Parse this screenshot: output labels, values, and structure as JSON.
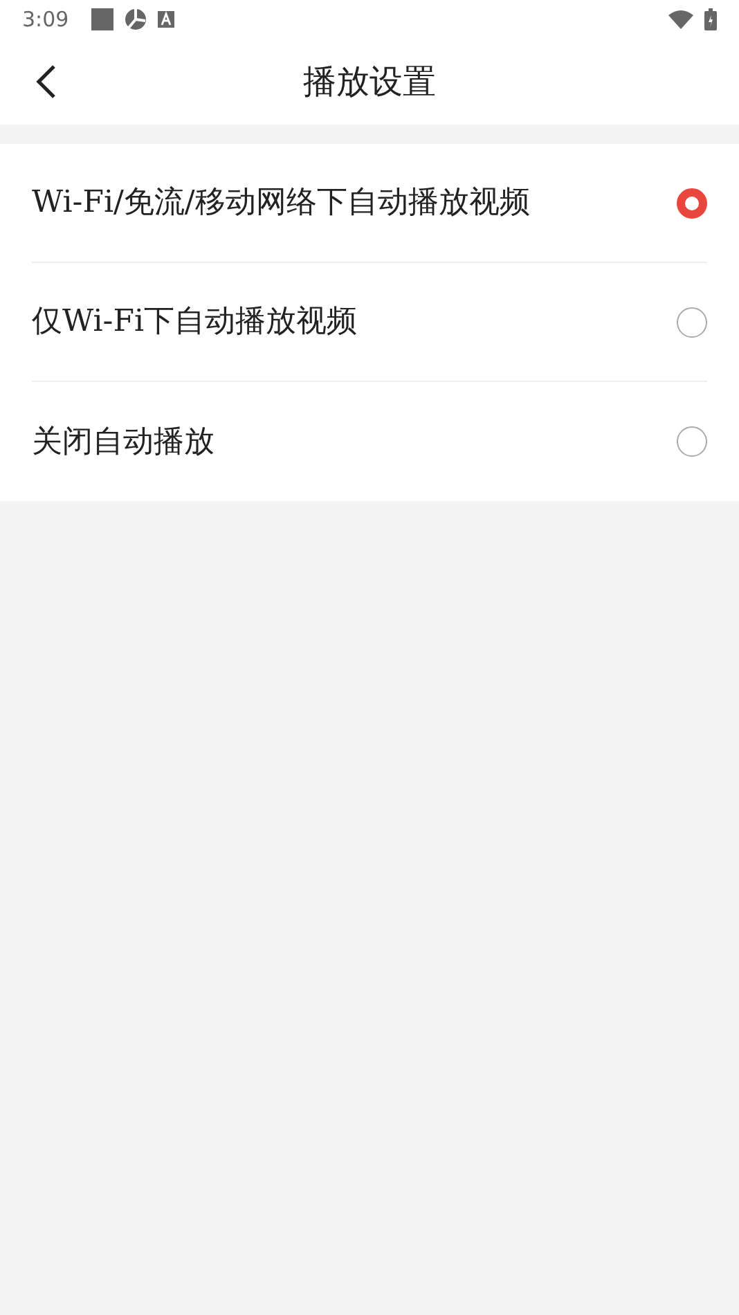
{
  "status_bar": {
    "time": "3:09"
  },
  "header": {
    "title": "播放设置"
  },
  "options": [
    {
      "label": "Wi-Fi/免流/移动网络下自动播放视频",
      "selected": true
    },
    {
      "label": "仅Wi-Fi下自动播放视频",
      "selected": false
    },
    {
      "label": "关闭自动播放",
      "selected": false
    }
  ]
}
